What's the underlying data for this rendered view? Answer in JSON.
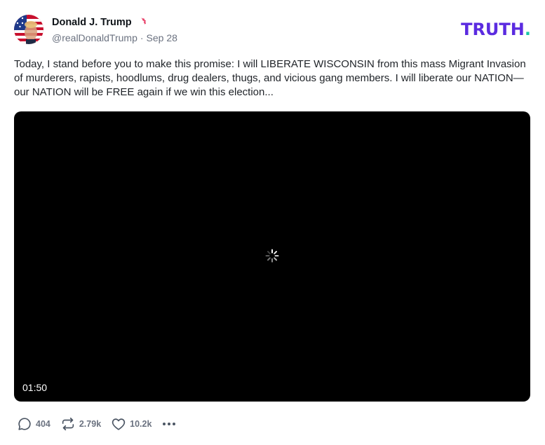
{
  "author": {
    "display_name": "Donald J. Trump",
    "handle": "@realDonaldTrump",
    "separator": "·",
    "date": "Sep 28",
    "verified": true,
    "avatar_icon": "avatar-flag-portrait"
  },
  "brand": {
    "name": "TRUTH",
    "dot": ".",
    "color": "#5b2be0",
    "dot_color": "#17c8a6"
  },
  "post": {
    "text": "Today, I stand before you to make this promise: I will LIBERATE WISCONSIN from this mass Migrant Invasion of murderers, rapists, hoodlums, drug dealers, thugs, and vicious gang members. I will liberate our NATION—our NATION will be FREE again if we win this election..."
  },
  "video": {
    "duration": "01:50",
    "state_icon": "loading-spinner-icon"
  },
  "actions": {
    "replies": {
      "icon": "reply-icon",
      "count": "404"
    },
    "retruths": {
      "icon": "repost-icon",
      "count": "2.79k"
    },
    "likes": {
      "icon": "heart-icon",
      "count": "10.2k"
    },
    "more": {
      "icon": "more-icon"
    }
  },
  "colors": {
    "verified_badge": "#e8436a",
    "text_muted": "#6b7280",
    "video_bg": "#000000"
  }
}
